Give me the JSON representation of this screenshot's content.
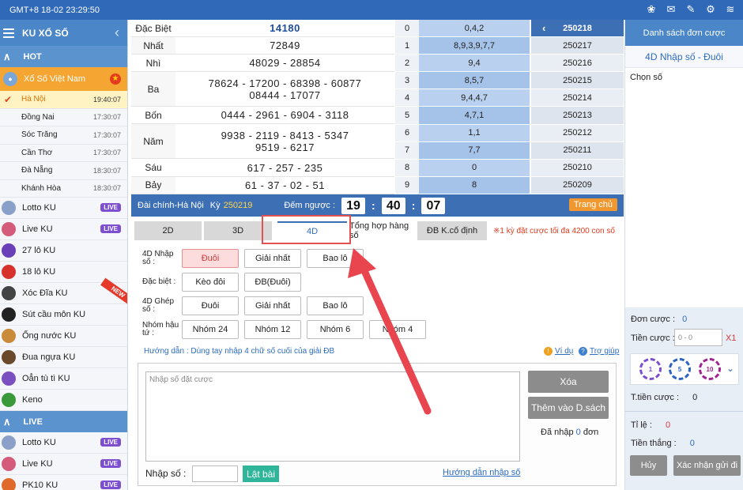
{
  "topbar": {
    "time": "GMT+8 18-02 23:29:50",
    "icons": [
      "gift-icon",
      "mail-icon",
      "tools-icon",
      "gear-icon",
      "wifi-icon"
    ]
  },
  "sidebar": {
    "title": "KU XỔ SỐ",
    "hot_label": "HOT",
    "featured": "Xổ Số Việt Nam",
    "cities": [
      {
        "name": "Hà Nội",
        "time": "19:40:07"
      },
      {
        "name": "Đồng Nai",
        "time": "17:30:07"
      },
      {
        "name": "Sóc Trăng",
        "time": "17:30:07"
      },
      {
        "name": "Cần Thơ",
        "time": "17:30:07"
      },
      {
        "name": "Đà Nẵng",
        "time": "18:30:07"
      },
      {
        "name": "Khánh Hòa",
        "time": "18:30:07"
      }
    ],
    "games": [
      "Lotto KU",
      "Live KU",
      "27 lô KU",
      "18 lô KU",
      "Xóc Đĩa KU",
      "Sút cầu môn KU",
      "Ống nước KU",
      "Đua ngựa KU",
      "Oẳn tù tì KU",
      "Keno"
    ],
    "live_badge": "LIVE",
    "new_badge": "NEW",
    "live_section": "LIVE",
    "live_games": [
      "Lotto KU",
      "Live KU",
      "PK10 KU"
    ]
  },
  "results": [
    {
      "label": "Đặc Biệt",
      "lines": [
        "14180"
      ]
    },
    {
      "label": "Nhất",
      "lines": [
        "72849"
      ]
    },
    {
      "label": "Nhì",
      "lines": [
        "48029 - 28854"
      ]
    },
    {
      "label": "Ba",
      "lines": [
        "78624 - 17200 - 68398 - 60877",
        "08444 - 17077"
      ]
    },
    {
      "label": "Bốn",
      "lines": [
        "0444 - 2961 - 6904 - 3118"
      ]
    },
    {
      "label": "Năm",
      "lines": [
        "9938 - 2119 - 8413 - 5347",
        "9519 - 6217"
      ]
    },
    {
      "label": "Sáu",
      "lines": [
        "617 - 257 - 235"
      ]
    },
    {
      "label": "Bảy",
      "lines": [
        "61 - 37 - 02 - 51"
      ]
    }
  ],
  "dau": [
    {
      "n": "0",
      "v": "0,4,2"
    },
    {
      "n": "1",
      "v": "8,9,3,9,7,7"
    },
    {
      "n": "2",
      "v": "9,4"
    },
    {
      "n": "3",
      "v": "8,5,7"
    },
    {
      "n": "4",
      "v": "9,4,4,7"
    },
    {
      "n": "5",
      "v": "4,7,1"
    },
    {
      "n": "6",
      "v": "1,1"
    },
    {
      "n": "7",
      "v": "7,7"
    },
    {
      "n": "8",
      "v": "0"
    },
    {
      "n": "9",
      "v": "8"
    }
  ],
  "ky": [
    "250218",
    "250217",
    "250216",
    "250215",
    "250214",
    "250213",
    "250212",
    "250211",
    "250210",
    "250209"
  ],
  "infobar": {
    "dai": "Đài chính-Hà Nội",
    "ky_label": "Kỳ",
    "ky_value": "250219",
    "countdown_label": "Đếm ngược :",
    "h": "19",
    "m": "40",
    "s": "07",
    "home": "Trang chủ"
  },
  "tabs": [
    "2D",
    "3D",
    "4D",
    "Tổng hợp hàng số",
    "ĐB K.cố định"
  ],
  "notice": "※1 kỳ đặt cược tối đa 4200 con số",
  "options": [
    {
      "label": "4D Nhập số :",
      "buttons": [
        "Đuôi",
        "Giải nhất",
        "Bao lô"
      ]
    },
    {
      "label": "Đặc biệt :",
      "buttons": [
        "Kèo đôi",
        "ĐB(Đuôi)"
      ]
    },
    {
      "label": "4D Ghép số :",
      "buttons": [
        "Đuôi",
        "Giải nhất",
        "Bao lô"
      ]
    },
    {
      "label": "Nhóm hậu tứ :",
      "buttons": [
        "Nhóm 24",
        "Nhóm 12",
        "Nhóm 6",
        "Nhóm 4"
      ]
    }
  ],
  "guide": "Hướng dẫn : Dùng tay nhập 4 chữ số cuối của giải ĐB",
  "vidu": "Ví dụ",
  "trogiup": "Trợ giúp",
  "input": {
    "placeholder": "Nhập số đặt cược",
    "xoa": "Xóa",
    "them": "Thêm vào D.sách",
    "da_nhap": "Đã nhập",
    "da_nhap_count": "0",
    "don": "đơn",
    "nhap_so": "Nhập số :",
    "lat_bai": "Lật bài",
    "huong_dan": "Hướng dẫn nhập số"
  },
  "right": {
    "title": "Danh sách đơn cược",
    "sub": "4D Nhập số - Đuôi",
    "chon": "Chọn số",
    "don_cuoc": "Đơn cược :",
    "don_cuoc_val": "0",
    "tien_cuoc": "Tiền cược :",
    "tien_placeholder": "0 - 0",
    "x1": "X1",
    "chips": [
      "1",
      "5",
      "10"
    ],
    "t_tien": "T.tiền cược :",
    "t_tien_val": "0",
    "ti_le": "Tỉ lệ :",
    "ti_le_val": "0",
    "tien_thang": "Tiền thắng :",
    "tien_thang_val": "0",
    "huy": "Hủy",
    "xac_nhan": "Xác nhận gửi đi"
  },
  "colors": {
    "brand": "#3d6fb5",
    "accent": "#f19730",
    "selected": "#d43a3a",
    "annotation": "#e35050"
  }
}
